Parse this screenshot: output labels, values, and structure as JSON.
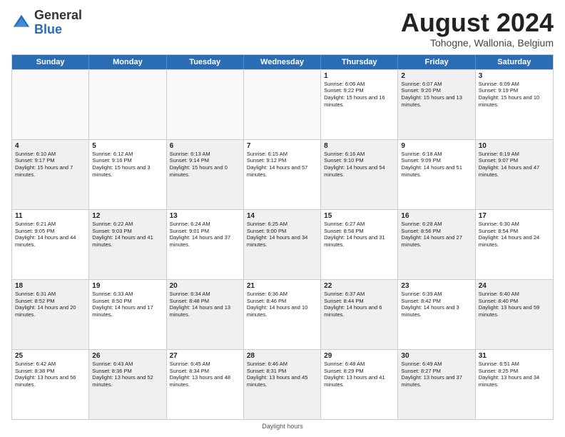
{
  "header": {
    "logo_general": "General",
    "logo_blue": "Blue",
    "month_title": "August 2024",
    "location": "Tohogne, Wallonia, Belgium"
  },
  "days_of_week": [
    "Sunday",
    "Monday",
    "Tuesday",
    "Wednesday",
    "Thursday",
    "Friday",
    "Saturday"
  ],
  "footer": "Daylight hours",
  "rows": [
    [
      {
        "day": "",
        "sunrise": "",
        "sunset": "",
        "daylight": "",
        "shaded": false,
        "empty": true
      },
      {
        "day": "",
        "sunrise": "",
        "sunset": "",
        "daylight": "",
        "shaded": false,
        "empty": true
      },
      {
        "day": "",
        "sunrise": "",
        "sunset": "",
        "daylight": "",
        "shaded": false,
        "empty": true
      },
      {
        "day": "",
        "sunrise": "",
        "sunset": "",
        "daylight": "",
        "shaded": false,
        "empty": true
      },
      {
        "day": "1",
        "sunrise": "Sunrise: 6:06 AM",
        "sunset": "Sunset: 9:22 PM",
        "daylight": "Daylight: 15 hours and 16 minutes.",
        "shaded": false,
        "empty": false
      },
      {
        "day": "2",
        "sunrise": "Sunrise: 6:07 AM",
        "sunset": "Sunset: 9:20 PM",
        "daylight": "Daylight: 15 hours and 13 minutes.",
        "shaded": true,
        "empty": false
      },
      {
        "day": "3",
        "sunrise": "Sunrise: 6:09 AM",
        "sunset": "Sunset: 9:19 PM",
        "daylight": "Daylight: 15 hours and 10 minutes.",
        "shaded": false,
        "empty": false
      }
    ],
    [
      {
        "day": "4",
        "sunrise": "Sunrise: 6:10 AM",
        "sunset": "Sunset: 9:17 PM",
        "daylight": "Daylight: 15 hours and 7 minutes.",
        "shaded": true,
        "empty": false
      },
      {
        "day": "5",
        "sunrise": "Sunrise: 6:12 AM",
        "sunset": "Sunset: 9:16 PM",
        "daylight": "Daylight: 15 hours and 3 minutes.",
        "shaded": false,
        "empty": false
      },
      {
        "day": "6",
        "sunrise": "Sunrise: 6:13 AM",
        "sunset": "Sunset: 9:14 PM",
        "daylight": "Daylight: 15 hours and 0 minutes.",
        "shaded": true,
        "empty": false
      },
      {
        "day": "7",
        "sunrise": "Sunrise: 6:15 AM",
        "sunset": "Sunset: 9:12 PM",
        "daylight": "Daylight: 14 hours and 57 minutes.",
        "shaded": false,
        "empty": false
      },
      {
        "day": "8",
        "sunrise": "Sunrise: 6:16 AM",
        "sunset": "Sunset: 9:10 PM",
        "daylight": "Daylight: 14 hours and 54 minutes.",
        "shaded": true,
        "empty": false
      },
      {
        "day": "9",
        "sunrise": "Sunrise: 6:18 AM",
        "sunset": "Sunset: 9:09 PM",
        "daylight": "Daylight: 14 hours and 51 minutes.",
        "shaded": false,
        "empty": false
      },
      {
        "day": "10",
        "sunrise": "Sunrise: 6:19 AM",
        "sunset": "Sunset: 9:07 PM",
        "daylight": "Daylight: 14 hours and 47 minutes.",
        "shaded": true,
        "empty": false
      }
    ],
    [
      {
        "day": "11",
        "sunrise": "Sunrise: 6:21 AM",
        "sunset": "Sunset: 9:05 PM",
        "daylight": "Daylight: 14 hours and 44 minutes.",
        "shaded": false,
        "empty": false
      },
      {
        "day": "12",
        "sunrise": "Sunrise: 6:22 AM",
        "sunset": "Sunset: 9:03 PM",
        "daylight": "Daylight: 14 hours and 41 minutes.",
        "shaded": true,
        "empty": false
      },
      {
        "day": "13",
        "sunrise": "Sunrise: 6:24 AM",
        "sunset": "Sunset: 9:01 PM",
        "daylight": "Daylight: 14 hours and 37 minutes.",
        "shaded": false,
        "empty": false
      },
      {
        "day": "14",
        "sunrise": "Sunrise: 6:25 AM",
        "sunset": "Sunset: 9:00 PM",
        "daylight": "Daylight: 14 hours and 34 minutes.",
        "shaded": true,
        "empty": false
      },
      {
        "day": "15",
        "sunrise": "Sunrise: 6:27 AM",
        "sunset": "Sunset: 8:58 PM",
        "daylight": "Daylight: 14 hours and 31 minutes.",
        "shaded": false,
        "empty": false
      },
      {
        "day": "16",
        "sunrise": "Sunrise: 6:28 AM",
        "sunset": "Sunset: 8:56 PM",
        "daylight": "Daylight: 14 hours and 27 minutes.",
        "shaded": true,
        "empty": false
      },
      {
        "day": "17",
        "sunrise": "Sunrise: 6:30 AM",
        "sunset": "Sunset: 8:54 PM",
        "daylight": "Daylight: 14 hours and 24 minutes.",
        "shaded": false,
        "empty": false
      }
    ],
    [
      {
        "day": "18",
        "sunrise": "Sunrise: 6:31 AM",
        "sunset": "Sunset: 8:52 PM",
        "daylight": "Daylight: 14 hours and 20 minutes.",
        "shaded": true,
        "empty": false
      },
      {
        "day": "19",
        "sunrise": "Sunrise: 6:33 AM",
        "sunset": "Sunset: 8:50 PM",
        "daylight": "Daylight: 14 hours and 17 minutes.",
        "shaded": false,
        "empty": false
      },
      {
        "day": "20",
        "sunrise": "Sunrise: 6:34 AM",
        "sunset": "Sunset: 8:48 PM",
        "daylight": "Daylight: 14 hours and 13 minutes.",
        "shaded": true,
        "empty": false
      },
      {
        "day": "21",
        "sunrise": "Sunrise: 6:36 AM",
        "sunset": "Sunset: 8:46 PM",
        "daylight": "Daylight: 14 hours and 10 minutes.",
        "shaded": false,
        "empty": false
      },
      {
        "day": "22",
        "sunrise": "Sunrise: 6:37 AM",
        "sunset": "Sunset: 8:44 PM",
        "daylight": "Daylight: 14 hours and 6 minutes.",
        "shaded": true,
        "empty": false
      },
      {
        "day": "23",
        "sunrise": "Sunrise: 6:39 AM",
        "sunset": "Sunset: 8:42 PM",
        "daylight": "Daylight: 14 hours and 3 minutes.",
        "shaded": false,
        "empty": false
      },
      {
        "day": "24",
        "sunrise": "Sunrise: 6:40 AM",
        "sunset": "Sunset: 8:40 PM",
        "daylight": "Daylight: 13 hours and 59 minutes.",
        "shaded": true,
        "empty": false
      }
    ],
    [
      {
        "day": "25",
        "sunrise": "Sunrise: 6:42 AM",
        "sunset": "Sunset: 8:38 PM",
        "daylight": "Daylight: 13 hours and 56 minutes.",
        "shaded": false,
        "empty": false
      },
      {
        "day": "26",
        "sunrise": "Sunrise: 6:43 AM",
        "sunset": "Sunset: 8:36 PM",
        "daylight": "Daylight: 13 hours and 52 minutes.",
        "shaded": true,
        "empty": false
      },
      {
        "day": "27",
        "sunrise": "Sunrise: 6:45 AM",
        "sunset": "Sunset: 8:34 PM",
        "daylight": "Daylight: 13 hours and 48 minutes.",
        "shaded": false,
        "empty": false
      },
      {
        "day": "28",
        "sunrise": "Sunrise: 6:46 AM",
        "sunset": "Sunset: 8:31 PM",
        "daylight": "Daylight: 13 hours and 45 minutes.",
        "shaded": true,
        "empty": false
      },
      {
        "day": "29",
        "sunrise": "Sunrise: 6:48 AM",
        "sunset": "Sunset: 8:29 PM",
        "daylight": "Daylight: 13 hours and 41 minutes.",
        "shaded": false,
        "empty": false
      },
      {
        "day": "30",
        "sunrise": "Sunrise: 6:49 AM",
        "sunset": "Sunset: 8:27 PM",
        "daylight": "Daylight: 13 hours and 37 minutes.",
        "shaded": true,
        "empty": false
      },
      {
        "day": "31",
        "sunrise": "Sunrise: 6:51 AM",
        "sunset": "Sunset: 8:25 PM",
        "daylight": "Daylight: 13 hours and 34 minutes.",
        "shaded": false,
        "empty": false
      }
    ]
  ]
}
